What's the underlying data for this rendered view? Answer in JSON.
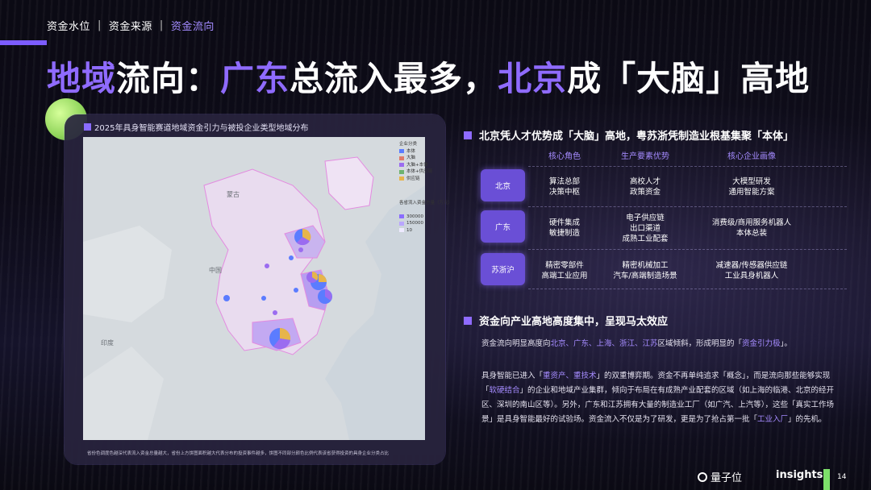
{
  "nav": {
    "items": [
      "资金水位",
      "资金来源",
      "资金流向"
    ],
    "active_index": 2
  },
  "title": {
    "part1": "地域",
    "part2": "流向：",
    "part3": "广东",
    "part4": "总流入最多，",
    "part5": "北京",
    "part6": "成「大脑」高地"
  },
  "map": {
    "title": "2025年具身智能赛道地域资金引力与被投企业类型地域分布",
    "labels": {
      "mongolia": "蒙古",
      "china": "中国",
      "india": "印度"
    },
    "legend": {
      "category_title": "企业分类",
      "categories": [
        {
          "label": "本体",
          "color": "#5b7cff"
        },
        {
          "label": "大脑",
          "color": "#e07b6a"
        },
        {
          "label": "大脑+本体",
          "color": "#9b6cf0"
        },
        {
          "label": "本体+供应链",
          "color": "#6fb36f"
        },
        {
          "label": "供应链",
          "color": "#e7b54b"
        }
      ],
      "size_title": "各省流入资金总量（万元）",
      "sizes": [
        "300000",
        "150000",
        "10"
      ]
    },
    "note": "省份色调度色越深代表流入资金总量越大，省份上方饼图面积越大代表分布的投资事件越多，饼图不同部分颜色比例代表该省获得投资的具身企业分类占比"
  },
  "section1": {
    "heading": "北京凭人才优势成「大脑」高地，粤苏浙凭制造业根基集聚「本体」",
    "columns": [
      "核心角色",
      "生产要素优势",
      "核心企业画像"
    ],
    "rows": [
      {
        "region": "北京",
        "role": [
          "算法总部",
          "决策中枢"
        ],
        "factor": [
          "高校人才",
          "政策资金"
        ],
        "profile": [
          "大模型研发",
          "通用智能方案"
        ]
      },
      {
        "region": "广东",
        "role": [
          "硬件集成",
          "敏捷制造"
        ],
        "factor": [
          "电子供应链",
          "出口渠道",
          "成熟工业配套"
        ],
        "profile": [
          "消费级/商用服务机器人",
          "本体总装"
        ]
      },
      {
        "region": "苏浙沪",
        "role": [
          "精密零部件",
          "高端工业应用"
        ],
        "factor": [
          "精密机械加工",
          "汽车/高端制造场景"
        ],
        "profile": [
          "减速器/传感器供应链",
          "工业具身机器人"
        ]
      }
    ]
  },
  "section2": {
    "heading": "资金向产业高地高度集中，呈现马太效应",
    "p1_a": "资金流向明显高度向",
    "p1_b": "北京、广东、上海、浙江、江苏",
    "p1_c": "区域倾斜，形成明显的「",
    "p1_d": "资金引力极",
    "p1_e": "」。",
    "p2_a": "具身智能已进入「",
    "p2_b": "重资产、重技术",
    "p2_c": "」的双重博弈期。资金不再单纯追求「概念」，而是流向那些能够实现「",
    "p2_d": "软硬结合",
    "p2_e": "」的企业和地域产业集群，倾向于布局在有成熟产业配套的区域（如上海的临港、北京的经开区、深圳的南山区等）。另外，广东和江苏拥有大量的制造业工厂（如广汽、上汽等），这些「真实工作场景」是具身智能最好的试验场。资金流入不仅是为了研发，更是为了抢占第一批「",
    "p2_f": "工业入厂",
    "p2_g": "」的先机。"
  },
  "footer": {
    "logo": "量子位",
    "insights": "insights",
    "page": "14"
  },
  "colors": {
    "accent": "#8f6bff",
    "green": "#7de06a"
  }
}
